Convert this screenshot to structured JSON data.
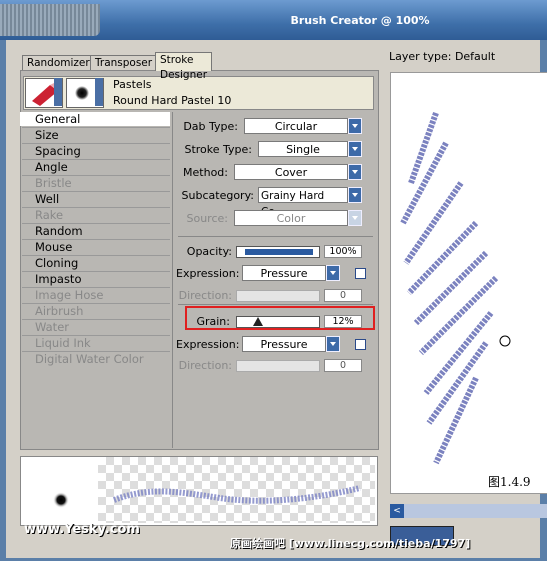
{
  "window": {
    "title": "Brush Creator @ 100%"
  },
  "tabs": [
    {
      "label": "Randomizer"
    },
    {
      "label": "Transposer"
    },
    {
      "label": "Stroke Designer"
    }
  ],
  "brush": {
    "category": "Pastels",
    "variant": "Round Hard Pastel 10"
  },
  "categories": [
    {
      "label": "General",
      "state": "selected"
    },
    {
      "label": "Size",
      "state": "enabled"
    },
    {
      "label": "Spacing",
      "state": "enabled"
    },
    {
      "label": "Angle",
      "state": "enabled"
    },
    {
      "label": "Bristle",
      "state": "disabled"
    },
    {
      "label": "Well",
      "state": "enabled"
    },
    {
      "label": "Rake",
      "state": "disabled"
    },
    {
      "label": "Random",
      "state": "enabled"
    },
    {
      "label": "Mouse",
      "state": "enabled"
    },
    {
      "label": "Cloning",
      "state": "enabled"
    },
    {
      "label": "Impasto",
      "state": "enabled"
    },
    {
      "label": "Image Hose",
      "state": "disabled"
    },
    {
      "label": "Airbrush",
      "state": "disabled"
    },
    {
      "label": "Water",
      "state": "disabled"
    },
    {
      "label": "Liquid Ink",
      "state": "disabled"
    },
    {
      "label": "Digital Water Color",
      "state": "disabled"
    }
  ],
  "general": {
    "dab_type_label": "Dab Type:",
    "dab_type_value": "Circular",
    "stroke_type_label": "Stroke Type:",
    "stroke_type_value": "Single",
    "method_label": "Method:",
    "method_value": "Cover",
    "subcategory_label": "Subcategory:",
    "subcategory_value": "Grainy Hard Co...",
    "source_label": "Source:",
    "source_value": "Color",
    "opacity_label": "Opacity:",
    "opacity_value": "100%",
    "opacity_fraction": 1.0,
    "expression1_label": "Expression:",
    "expression1_value": "Pressure",
    "direction1_label": "Direction:",
    "direction1_value": "0",
    "grain_label": "Grain:",
    "grain_value": "12%",
    "grain_fraction": 0.12,
    "expression2_label": "Expression:",
    "expression2_value": "Pressure",
    "direction2_label": "Direction:",
    "direction2_value": "0"
  },
  "layer_type": "Layer type: Default",
  "figure_caption": "图1.4.9",
  "watermark_left": "www.Yesky.com",
  "watermark_right": "原画绘画吧 [www.linecg.com/tieba/1797]",
  "colors": {
    "stroke": "#5b63b0",
    "highlight": "#e02020",
    "title_bar": "#3e6fa9"
  }
}
